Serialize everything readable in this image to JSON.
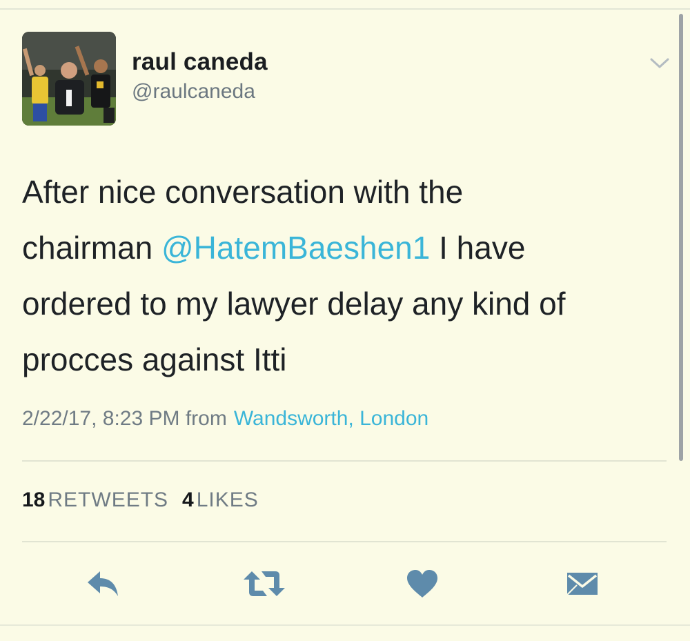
{
  "tweet": {
    "author": {
      "display_name": "raul caneda",
      "handle": "@raulcaneda"
    },
    "text_parts": {
      "line1": "After nice conversation with the",
      "before_mention": "chairman ",
      "mention": "@HatemBaeshen1",
      "after_mention": " I have",
      "line3": "ordered to my lawyer delay any kind of",
      "line4": "procces against Itti"
    },
    "timestamp": "2/22/17, 8:23 PM from",
    "location": "Wandsworth, London",
    "stats": {
      "retweets_count": "18",
      "retweets_label": "RETWEETS",
      "likes_count": "4",
      "likes_label": "LIKES"
    }
  },
  "icons": {
    "more": "chevron-down-icon",
    "reply": "reply-icon",
    "retweet": "retweet-icon",
    "like": "heart-icon",
    "message": "envelope-icon"
  },
  "colors": {
    "background": "#fbfbe6",
    "link": "#3ab5d8",
    "action_icon": "#5e8bab",
    "muted_text": "#6f7b84"
  }
}
